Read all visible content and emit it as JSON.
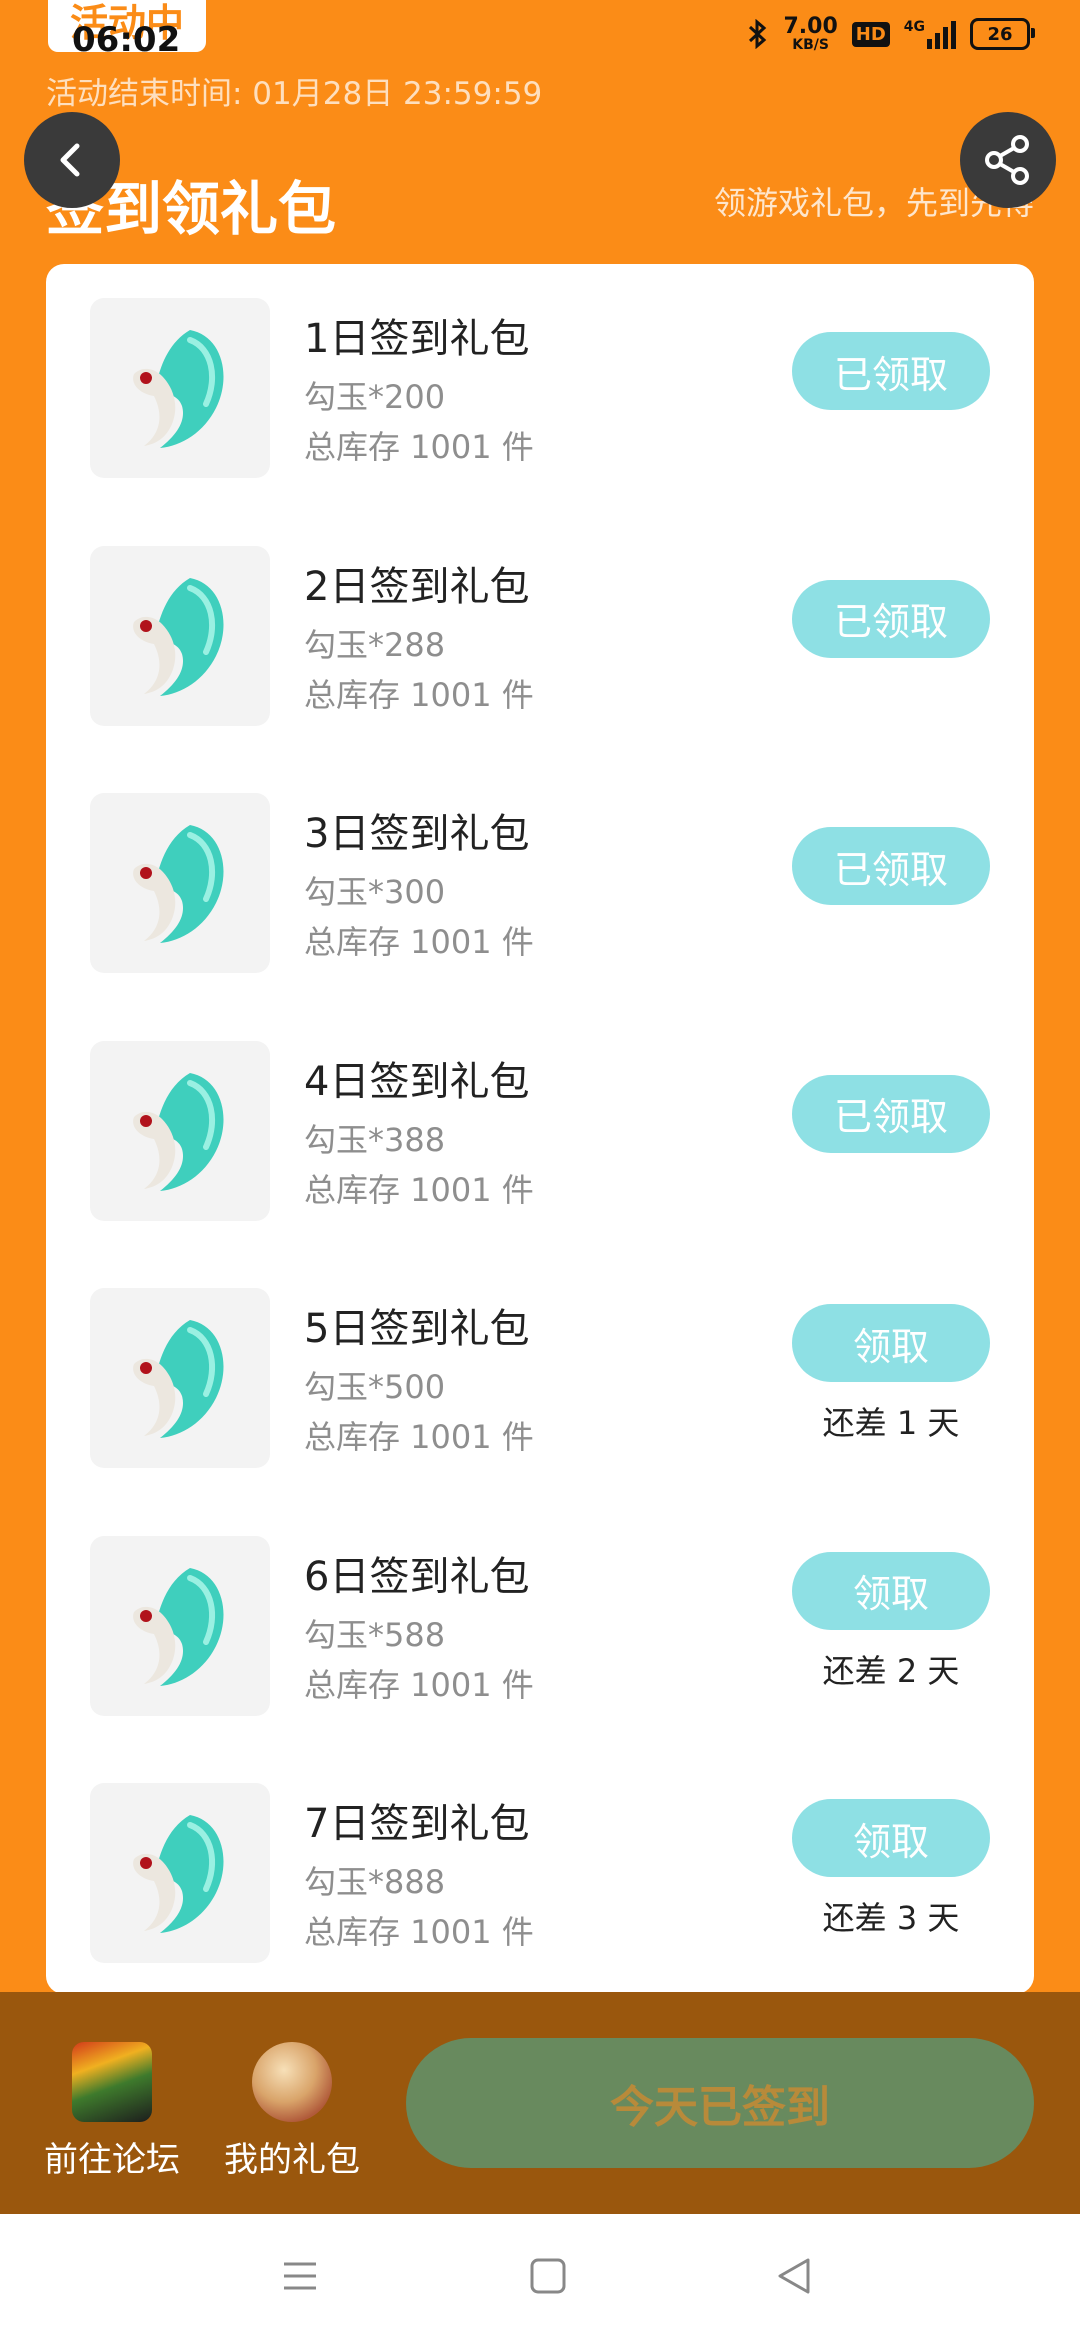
{
  "status_bar": {
    "activity_badge": "活动中",
    "time": "06:02",
    "net_speed_value": "7.00",
    "net_speed_unit": "KB/S",
    "hd_label": "HD",
    "network_label": "4G",
    "battery": "26"
  },
  "header": {
    "end_time": "活动结束时间: 01月28日 23:59:59",
    "title": "签到领礼包",
    "subtitle": "领游戏礼包，先到先得"
  },
  "gifts": [
    {
      "title": "1日签到礼包",
      "desc": "勾玉*200",
      "stock": "总库存 1001 件",
      "button": "已领取",
      "days_left": ""
    },
    {
      "title": "2日签到礼包",
      "desc": "勾玉*288",
      "stock": "总库存 1001 件",
      "button": "已领取",
      "days_left": ""
    },
    {
      "title": "3日签到礼包",
      "desc": "勾玉*300",
      "stock": "总库存 1001 件",
      "button": "已领取",
      "days_left": ""
    },
    {
      "title": "4日签到礼包",
      "desc": "勾玉*388",
      "stock": "总库存 1001 件",
      "button": "已领取",
      "days_left": ""
    },
    {
      "title": "5日签到礼包",
      "desc": "勾玉*500",
      "stock": "总库存 1001 件",
      "button": "领取",
      "days_left": "还差 1 天"
    },
    {
      "title": "6日签到礼包",
      "desc": "勾玉*588",
      "stock": "总库存 1001 件",
      "button": "领取",
      "days_left": "还差 2 天"
    },
    {
      "title": "7日签到礼包",
      "desc": "勾玉*888",
      "stock": "总库存 1001 件",
      "button": "领取",
      "days_left": "还差 3 天"
    }
  ],
  "bottom_bar": {
    "forum_label": "前往论坛",
    "my_gifts_label": "我的礼包",
    "checkin_label": "今天已签到"
  },
  "colors": {
    "header_orange": "#fb8c17",
    "claim_button": "#8ee0e4",
    "bottom_bar": "#9a570d",
    "checkin_button": "#688a5e"
  }
}
